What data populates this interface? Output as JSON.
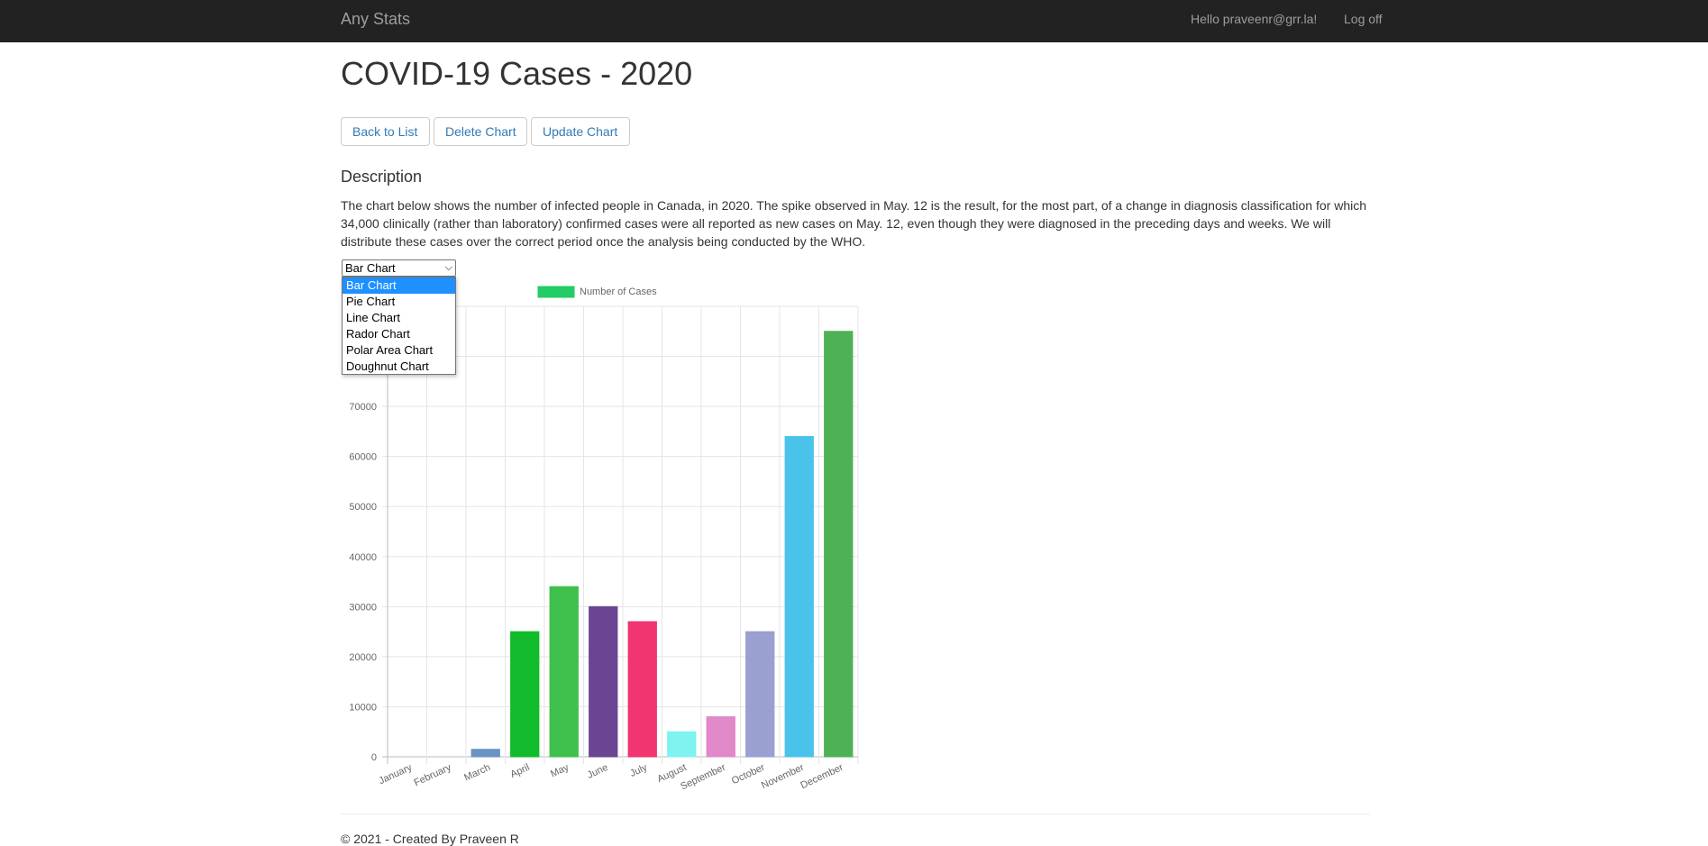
{
  "navbar": {
    "brand": "Any Stats",
    "hello": "Hello praveenr@grr.la!",
    "logoff": "Log off"
  },
  "page": {
    "title": "COVID-19 Cases - 2020",
    "buttons": {
      "back": "Back to List",
      "delete": "Delete Chart",
      "update": "Update Chart"
    },
    "description_heading": "Description",
    "description_text": "The chart below shows the number of infected people in Canada, in 2020. The spike observed in May. 12 is the result, for the most part, of a change in diagnosis classification for which 34,000 clinically (rather than laboratory) confirmed cases were all reported as new cases on May. 12, even though they were diagnosed in the preceding days and weeks. We will distribute these cases over the correct period once the analysis being conducted by the WHO."
  },
  "chart_type_select": {
    "selected": "Bar Chart",
    "options": [
      "Bar Chart",
      "Pie Chart",
      "Line Chart",
      "Rador Chart",
      "Polar Area Chart",
      "Doughnut Chart"
    ]
  },
  "footer": {
    "text": "© 2021 - Created By Praveen R"
  },
  "chart_data": {
    "type": "bar",
    "categories": [
      "January",
      "February",
      "March",
      "April",
      "May",
      "June",
      "July",
      "August",
      "September",
      "October",
      "November",
      "December"
    ],
    "series": [
      {
        "name": "Number of Cases",
        "values": [
          0,
          0,
          1500,
          25000,
          34000,
          30000,
          27000,
          5000,
          8000,
          25000,
          64000,
          85000
        ],
        "colors": [
          "#6b93c3",
          "#6b93c3",
          "#6b93c3",
          "#12bb2b",
          "#3fc04d",
          "#6a4692",
          "#f03570",
          "#7ef3ef",
          "#e088c8",
          "#9aa0d0",
          "#4ac3ea",
          "#4fb155"
        ]
      }
    ],
    "ylim": [
      0,
      90000
    ],
    "yticks": [
      0,
      10000,
      20000,
      30000,
      40000,
      50000,
      60000,
      70000
    ],
    "legend_color": "#22cc66",
    "legend_position": "top",
    "grid": true
  }
}
